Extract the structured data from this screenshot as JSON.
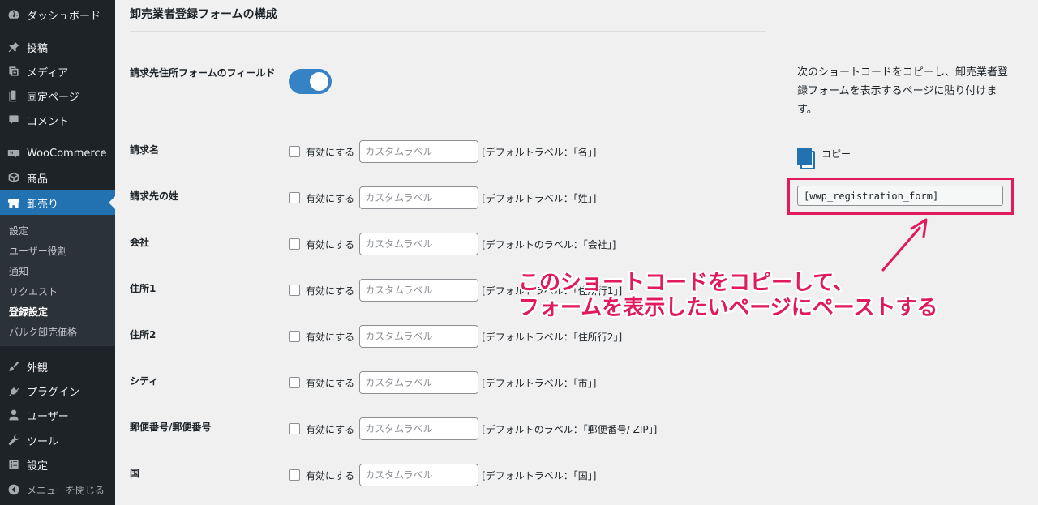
{
  "sidebar": {
    "items": [
      {
        "label": "ダッシュボード",
        "icon": "dashboard-icon"
      },
      {
        "label": "投稿",
        "icon": "pin-icon"
      },
      {
        "label": "メディア",
        "icon": "media-icon"
      },
      {
        "label": "固定ページ",
        "icon": "page-icon"
      },
      {
        "label": "コメント",
        "icon": "comment-icon"
      },
      {
        "label": "WooCommerce",
        "icon": "woocommerce-icon"
      },
      {
        "label": "商品",
        "icon": "box-icon"
      },
      {
        "label": "卸売り",
        "icon": "store-icon"
      },
      {
        "label": "外観",
        "icon": "brush-icon"
      },
      {
        "label": "プラグイン",
        "icon": "plugin-icon"
      },
      {
        "label": "ユーザー",
        "icon": "user-icon"
      },
      {
        "label": "ツール",
        "icon": "wrench-icon"
      },
      {
        "label": "設定",
        "icon": "settings-icon"
      },
      {
        "label": "メニューを閉じる",
        "icon": "collapse-icon"
      }
    ],
    "submenu": [
      "設定",
      "ユーザー役割",
      "通知",
      "リクエスト",
      "登録設定",
      "バルク卸売価格"
    ],
    "active_color": "#2271b1"
  },
  "main": {
    "section_title": "卸売業者登録フォームの構成",
    "toggle_field": {
      "label": "請求先住所フォームのフィールド",
      "state": "on"
    },
    "checkbox_label": "有効にする",
    "placeholder": "カスタムラベル",
    "rows": [
      {
        "label": "請求名",
        "default": "[デフォルトラベル：「名」]"
      },
      {
        "label": "請求先の姓",
        "default": "[デフォルトラベル：「姓」]"
      },
      {
        "label": "会社",
        "default": "[デフォルトのラベル：「会社」]"
      },
      {
        "label": "住所1",
        "default": "[デフォルトラベル：「住所行1」]"
      },
      {
        "label": "住所2",
        "default": "[デフォルトラベル：「住所行2」]"
      },
      {
        "label": "シティ",
        "default": "[デフォルトラベル：「市」]"
      },
      {
        "label": "郵便番号/郵便番号",
        "default": "[デフォルトのラベル：「郵便番号/ ZIP」]"
      },
      {
        "label": "国",
        "default": "[デフォルトラベル：「国」]"
      }
    ]
  },
  "right_panel": {
    "help_text": "次のショートコードをコピーし、卸売業者登録フォームを表示するページに貼り付けます。",
    "copy_label": "コピー",
    "shortcode": "[wwp_registration_form]"
  },
  "annotation": {
    "line1": "このショートコードをコピーして、",
    "line2": "フォームを表示したいページにペーストする",
    "color": "#e01a5d"
  }
}
